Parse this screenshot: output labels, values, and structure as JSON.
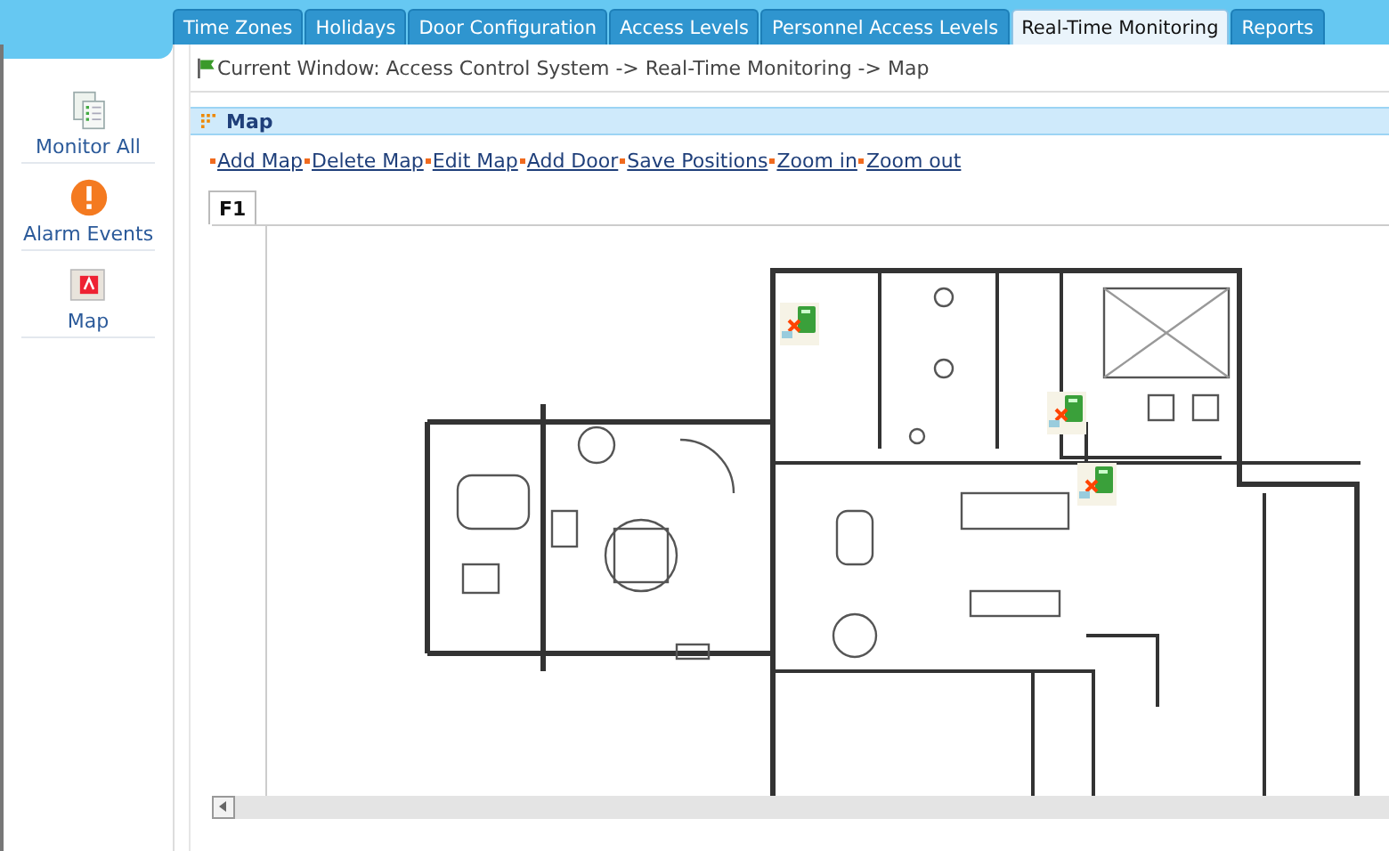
{
  "tabs": [
    {
      "label": "Time Zones",
      "selected": false
    },
    {
      "label": "Holidays",
      "selected": false
    },
    {
      "label": "Door Configuration",
      "selected": false
    },
    {
      "label": "Access Levels",
      "selected": false
    },
    {
      "label": "Personnel Access Levels",
      "selected": false
    },
    {
      "label": "Real-Time Monitoring",
      "selected": true
    },
    {
      "label": "Reports",
      "selected": false
    }
  ],
  "sidebar": {
    "items": [
      {
        "label": "Monitor All",
        "kind": "documents"
      },
      {
        "label": "Alarm Events",
        "kind": "alarm"
      },
      {
        "label": "Map",
        "kind": "map"
      }
    ]
  },
  "breadcrumb": "Current Window: Access Control System -> Real-Time Monitoring -> Map",
  "panel": {
    "title": "Map",
    "actions": [
      "Add Map",
      "Delete Map",
      "Edit Map",
      "Add Door",
      "Save Positions",
      "Zoom in",
      "Zoom out"
    ]
  },
  "map_tabs": [
    {
      "label": "F1",
      "selected": true
    }
  ]
}
